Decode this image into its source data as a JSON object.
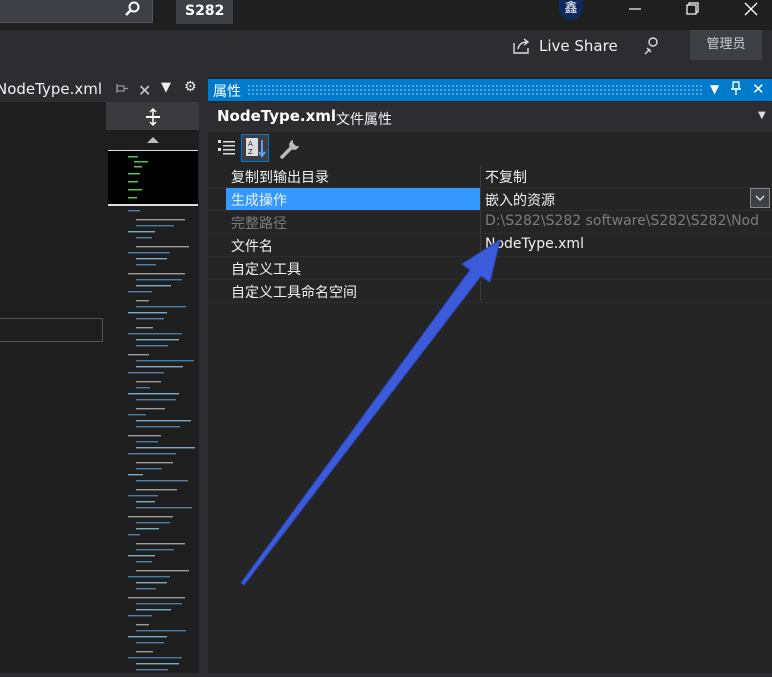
{
  "titlebar": {
    "solution_name": "S282",
    "avatar_initial": "鑫"
  },
  "command_bar": {
    "live_share_label": "Live Share",
    "admin_label": "管理员"
  },
  "document_tab": {
    "label": "NodeType.xml"
  },
  "properties_panel": {
    "title": "属性",
    "object_name": "NodeType.xml",
    "object_type": "文件属性",
    "rows": [
      {
        "name": "复制到输出目录",
        "value": "不复制"
      },
      {
        "name": "生成操作",
        "value": "嵌入的资源"
      },
      {
        "name": "完整路径",
        "value": "D:\\S282\\S282 software\\S282\\S282\\Nod"
      },
      {
        "name": "文件名",
        "value": "NodeType.xml"
      },
      {
        "name": "自定义工具",
        "value": ""
      },
      {
        "name": "自定义工具命名空间",
        "value": ""
      }
    ]
  },
  "colors": {
    "accent": "#007acc",
    "selection": "#3399ff",
    "annotation_arrow": "#3b5bdb"
  },
  "icons": [
    "search-icon",
    "live-share-icon",
    "feedback-icon",
    "pin-icon",
    "close-icon",
    "settings-icon",
    "categorized-icon",
    "alphabetical-icon",
    "property-pages-icon",
    "chevron-down-icon"
  ]
}
